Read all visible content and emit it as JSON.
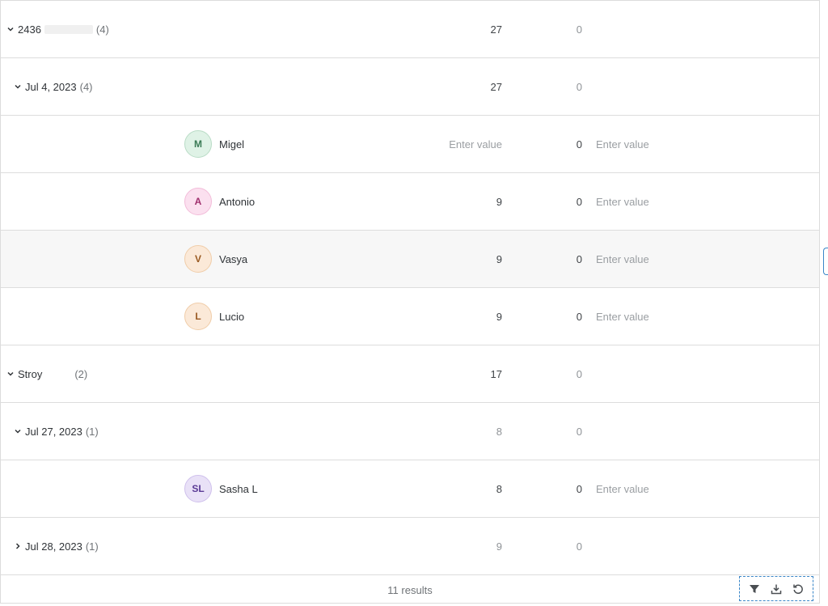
{
  "rows": [
    {
      "type": "group",
      "level": 0,
      "expanded": true,
      "label": "2436",
      "redacted": true,
      "count": "(4)",
      "col_a": "27",
      "col_b": "0"
    },
    {
      "type": "group",
      "level": 1,
      "expanded": true,
      "label": "Jul 4, 2023",
      "count": "(4)",
      "col_a": "27",
      "col_b": "0"
    },
    {
      "type": "person",
      "initials": "M",
      "name": "Migel",
      "avatar_color": "green",
      "col_a": "Enter value",
      "col_b": "0",
      "col_c": "Enter value"
    },
    {
      "type": "person",
      "initials": "A",
      "name": "Antonio",
      "avatar_color": "pink",
      "col_a": "9",
      "col_b": "0",
      "col_c": "Enter value"
    },
    {
      "type": "person",
      "initials": "V",
      "name": "Vasya",
      "avatar_color": "orange",
      "col_a": "9",
      "col_b": "0",
      "col_c": "Enter value",
      "hover": true
    },
    {
      "type": "person",
      "initials": "L",
      "name": "Lucio",
      "avatar_color": "orange",
      "col_a": "9",
      "col_b": "0",
      "col_c": "Enter value"
    },
    {
      "type": "group",
      "level": 0,
      "expanded": true,
      "label": "Stroy",
      "gap": true,
      "count": "(2)",
      "col_a": "17",
      "col_b": "0"
    },
    {
      "type": "group",
      "level": 1,
      "expanded": true,
      "label": "Jul 27, 2023",
      "count": "(1)",
      "col_a": "8",
      "col_b": "0",
      "muted_a": true
    },
    {
      "type": "person",
      "initials": "SL",
      "name": "Sasha L",
      "avatar_color": "purple",
      "col_a": "8",
      "col_b": "0",
      "col_c": "Enter value"
    },
    {
      "type": "group",
      "level": 1,
      "expanded": false,
      "label": "Jul 28, 2023",
      "count": "(1)",
      "col_a": "9",
      "col_b": "0",
      "muted_a": true
    }
  ],
  "footer": {
    "results": "11 results"
  },
  "toolbar": {
    "icons": [
      "filter-icon",
      "download-icon",
      "reset-icon"
    ]
  },
  "colors": {
    "accent": "#3a86c8",
    "border": "#dddddd",
    "hover_row": "#f7f7f7"
  }
}
